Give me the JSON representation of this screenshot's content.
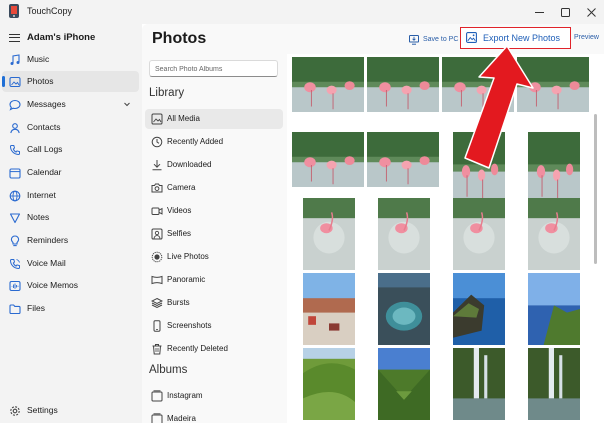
{
  "app": {
    "title": "TouchCopy"
  },
  "window_controls": [
    "minimize",
    "maximize",
    "close"
  ],
  "sidebar": {
    "device": "Adam's iPhone",
    "items": [
      {
        "label": "Music",
        "icon": "music-icon"
      },
      {
        "label": "Photos",
        "icon": "photo-icon",
        "active": true
      },
      {
        "label": "Messages",
        "icon": "message-icon",
        "expandable": true
      },
      {
        "label": "Contacts",
        "icon": "person-icon"
      },
      {
        "label": "Call Logs",
        "icon": "phone-icon"
      },
      {
        "label": "Calendar",
        "icon": "calendar-icon"
      },
      {
        "label": "Internet",
        "icon": "globe-icon"
      },
      {
        "label": "Notes",
        "icon": "note-icon"
      },
      {
        "label": "Reminders",
        "icon": "bulb-icon"
      },
      {
        "label": "Voice Mail",
        "icon": "voicemail-icon"
      },
      {
        "label": "Voice Memos",
        "icon": "voice-memo-icon"
      },
      {
        "label": "Files",
        "icon": "folder-icon"
      }
    ],
    "settings": "Settings"
  },
  "header": {
    "title": "Photos",
    "save_to_pc": "Save to PC",
    "export_new": "Export New Photos",
    "preview": "Preview"
  },
  "search": {
    "placeholder": "Search Photo Albums"
  },
  "library": {
    "heading": "Library",
    "items": [
      {
        "label": "All Media",
        "icon": "all-media-icon",
        "active": true
      },
      {
        "label": "Recently Added",
        "icon": "clock-icon"
      },
      {
        "label": "Downloaded",
        "icon": "download-icon"
      },
      {
        "label": "Camera",
        "icon": "camera-icon"
      },
      {
        "label": "Videos",
        "icon": "video-icon"
      },
      {
        "label": "Selfies",
        "icon": "selfie-icon"
      },
      {
        "label": "Live Photos",
        "icon": "live-photo-icon"
      },
      {
        "label": "Panoramic",
        "icon": "panorama-icon"
      },
      {
        "label": "Bursts",
        "icon": "burst-icon"
      },
      {
        "label": "Screenshots",
        "icon": "screenshot-icon"
      },
      {
        "label": "Recently Deleted",
        "icon": "trash-icon"
      }
    ]
  },
  "albums": {
    "heading": "Albums",
    "items": [
      {
        "label": "Instagram",
        "icon": "album-icon"
      },
      {
        "label": "Madeira",
        "icon": "album-icon"
      }
    ]
  },
  "photos": [
    {
      "scene": "flamingo",
      "row": 0,
      "col": 0,
      "orientation": "landscape"
    },
    {
      "scene": "flamingo",
      "row": 0,
      "col": 1,
      "orientation": "landscape"
    },
    {
      "scene": "flamingo",
      "row": 0,
      "col": 2,
      "orientation": "landscape"
    },
    {
      "scene": "flamingo",
      "row": 0,
      "col": 3,
      "orientation": "landscape"
    },
    {
      "scene": "flamingo",
      "row": 1,
      "col": 0,
      "orientation": "landscape"
    },
    {
      "scene": "flamingo",
      "row": 1,
      "col": 1,
      "orientation": "landscape"
    },
    {
      "scene": "flamingo",
      "row": 1,
      "col": 2,
      "orientation": "portrait"
    },
    {
      "scene": "flamingo",
      "row": 1,
      "col": 3,
      "orientation": "portrait"
    },
    {
      "scene": "flamingo-water",
      "row": 2,
      "col": 0,
      "orientation": "portrait"
    },
    {
      "scene": "flamingo-water",
      "row": 2,
      "col": 1,
      "orientation": "portrait"
    },
    {
      "scene": "flamingo-water",
      "row": 2,
      "col": 2,
      "orientation": "portrait"
    },
    {
      "scene": "flamingo-water",
      "row": 2,
      "col": 3,
      "orientation": "portrait"
    },
    {
      "scene": "coast-town",
      "row": 3,
      "col": 0,
      "orientation": "portrait"
    },
    {
      "scene": "rock-pool",
      "row": 3,
      "col": 1,
      "orientation": "portrait"
    },
    {
      "scene": "sea-cliff",
      "row": 3,
      "col": 2,
      "orientation": "portrait"
    },
    {
      "scene": "green-cliff",
      "row": 3,
      "col": 3,
      "orientation": "portrait"
    },
    {
      "scene": "green-hill",
      "row": 4,
      "col": 0,
      "orientation": "portrait"
    },
    {
      "scene": "valley",
      "row": 4,
      "col": 1,
      "orientation": "portrait"
    },
    {
      "scene": "waterfall",
      "row": 4,
      "col": 2,
      "orientation": "portrait"
    },
    {
      "scene": "waterfall",
      "row": 4,
      "col": 3,
      "orientation": "portrait"
    }
  ],
  "annotation": {
    "arrow_color": "#e3191f",
    "highlight_color": "#e0232a"
  },
  "colors": {
    "accent": "#1f6fd6",
    "link": "#2a5ea8"
  }
}
